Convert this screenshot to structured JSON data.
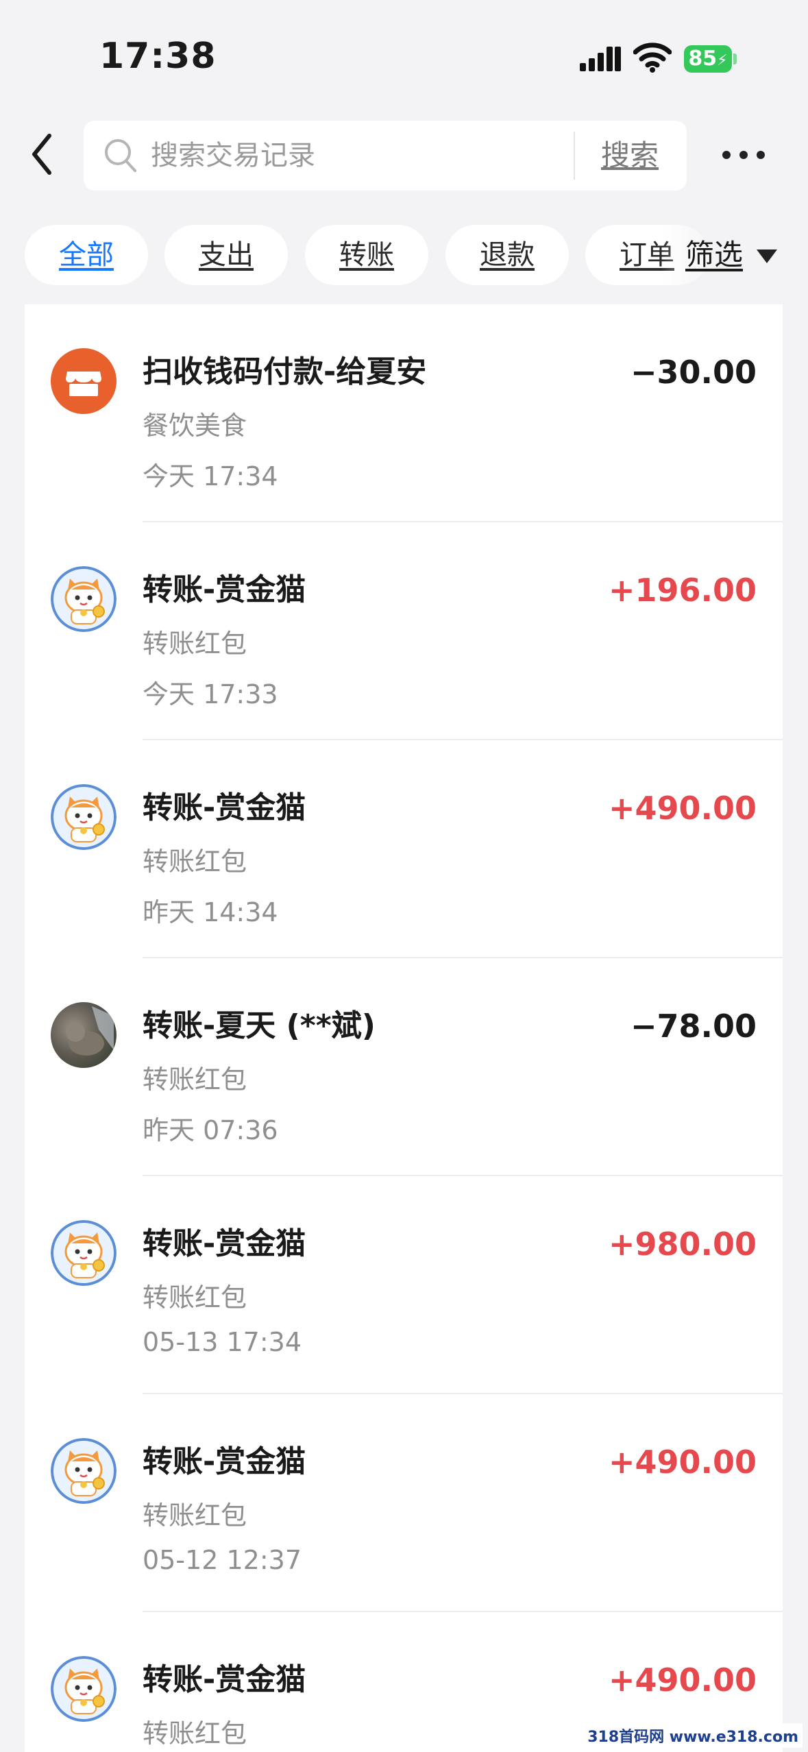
{
  "status_bar": {
    "time": "17:38",
    "battery": "85"
  },
  "header": {
    "search_placeholder": "搜索交易记录",
    "search_button": "搜索"
  },
  "filters": {
    "tabs": [
      {
        "label": "全部",
        "active": true
      },
      {
        "label": "支出",
        "active": false
      },
      {
        "label": "转账",
        "active": false
      },
      {
        "label": "退款",
        "active": false
      },
      {
        "label": "订单",
        "active": false
      }
    ],
    "filter_label": "筛选"
  },
  "transactions": [
    {
      "title": "扫收钱码付款-给夏安",
      "category": "餐饮美食",
      "time": "今天 17:34",
      "amount": "−30.00",
      "direction": "out",
      "avatar": "store-icon"
    },
    {
      "title": "转账-赏金猫",
      "category": "转账红包",
      "time": "今天 17:33",
      "amount": "+196.00",
      "direction": "in",
      "avatar": "lucky-cat-avatar"
    },
    {
      "title": "转账-赏金猫",
      "category": "转账红包",
      "time": "昨天 14:34",
      "amount": "+490.00",
      "direction": "in",
      "avatar": "lucky-cat-avatar"
    },
    {
      "title": "转账-夏天 (**斌)",
      "category": "转账红包",
      "time": "昨天 07:36",
      "amount": "−78.00",
      "direction": "out",
      "avatar": "photo-avatar"
    },
    {
      "title": "转账-赏金猫",
      "category": "转账红包",
      "time": "05-13 17:34",
      "amount": "+980.00",
      "direction": "in",
      "avatar": "lucky-cat-avatar"
    },
    {
      "title": "转账-赏金猫",
      "category": "转账红包",
      "time": "05-12 12:37",
      "amount": "+490.00",
      "direction": "in",
      "avatar": "lucky-cat-avatar"
    },
    {
      "title": "转账-赏金猫",
      "category": "转账红包",
      "time": "",
      "amount": "+490.00",
      "direction": "in",
      "avatar": "lucky-cat-avatar"
    }
  ],
  "watermark": "318首码网 www.e318.com",
  "colors": {
    "accent": "#1677ff",
    "income": "#e5484d",
    "store": "#e8602c",
    "battery": "#34c759"
  }
}
